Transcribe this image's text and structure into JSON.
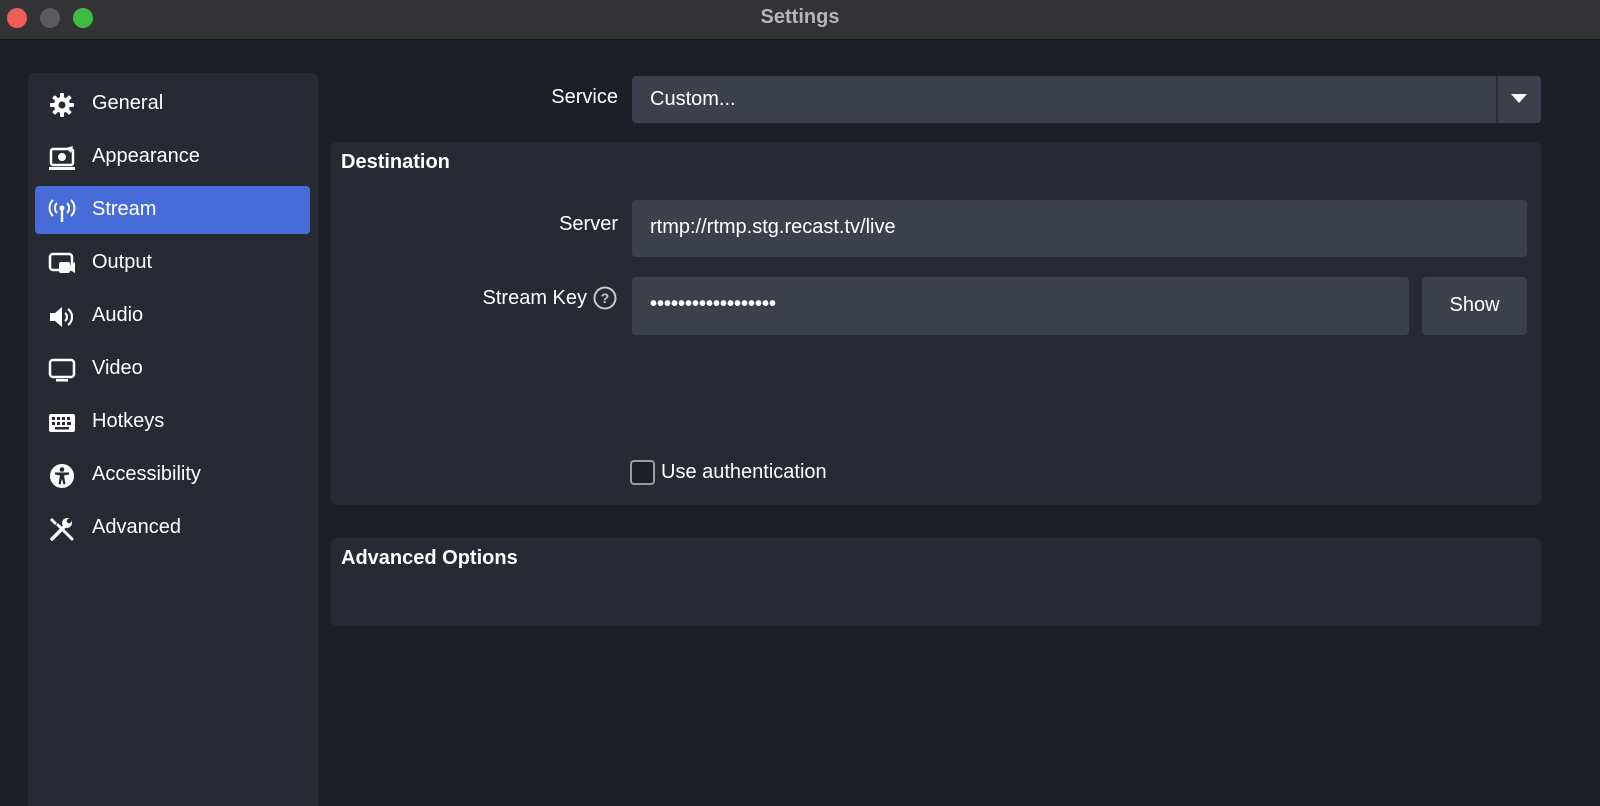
{
  "window": {
    "title": "Settings"
  },
  "sidebar": {
    "items": [
      {
        "label": "General",
        "icon": "gear-icon"
      },
      {
        "label": "Appearance",
        "icon": "appearance-icon"
      },
      {
        "label": "Stream",
        "icon": "antenna-icon",
        "active": true
      },
      {
        "label": "Output",
        "icon": "output-icon"
      },
      {
        "label": "Audio",
        "icon": "speaker-icon"
      },
      {
        "label": "Video",
        "icon": "monitor-icon"
      },
      {
        "label": "Hotkeys",
        "icon": "keyboard-icon"
      },
      {
        "label": "Accessibility",
        "icon": "accessibility-icon"
      },
      {
        "label": "Advanced",
        "icon": "wrench-screwdriver-icon"
      }
    ]
  },
  "service": {
    "label": "Service",
    "value": "Custom..."
  },
  "destination": {
    "title": "Destination",
    "server_label": "Server",
    "server_value": "rtmp://rtmp.stg.recast.tv/live",
    "stream_key_label": "Stream Key",
    "stream_key_value": "••••••••••••••••••",
    "show_label": "Show",
    "use_auth_label": "Use authentication",
    "use_auth_checked": false
  },
  "advanced_options": {
    "title": "Advanced Options"
  },
  "colors": {
    "background": "#1d1f26",
    "panel": "#272a33",
    "input": "#3c404d",
    "accent": "#476bd8"
  }
}
